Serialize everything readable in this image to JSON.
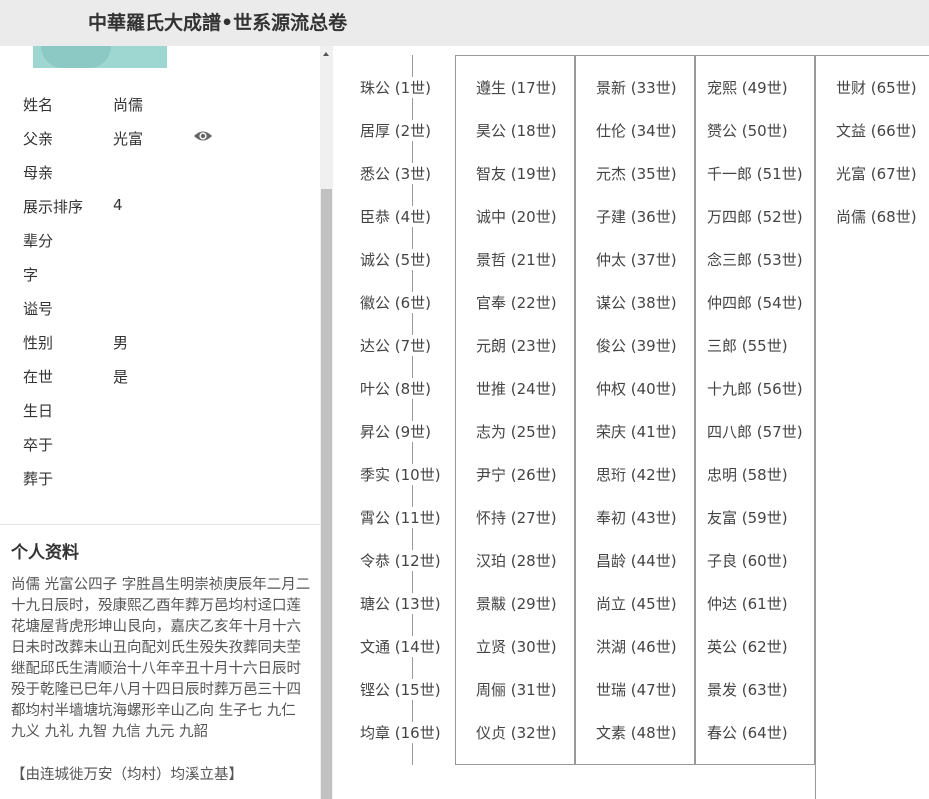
{
  "header": {
    "title": "中華羅氏大成譜•世系源流总卷"
  },
  "person": {
    "fields": [
      {
        "label": "姓名",
        "value": "尚儒"
      },
      {
        "label": "父亲",
        "value": "光富"
      },
      {
        "label": "母亲",
        "value": ""
      },
      {
        "label": "展示排序",
        "value": "4"
      },
      {
        "label": "辈分",
        "value": ""
      },
      {
        "label": "字",
        "value": ""
      },
      {
        "label": "谥号",
        "value": ""
      },
      {
        "label": "性别",
        "value": "男"
      },
      {
        "label": "在世",
        "value": "是"
      },
      {
        "label": "生日",
        "value": ""
      },
      {
        "label": "卒于",
        "value": ""
      },
      {
        "label": "葬于",
        "value": ""
      }
    ],
    "eye_icon": "eye-icon"
  },
  "profile": {
    "title": "个人资料",
    "text": "尚儒 光富公四子 字胜昌生明崇祯庚辰年二月二十九日辰时，殁康熙乙酉年葬万邑均村迳口莲花塘屋背虎形坤山艮向，嘉庆乙亥年十月十六日未时改葬未山丑向配刘氏生殁失孜葬同夫茔 继配邱氏生清顺治十八年辛丑十月十六日辰时殁于乾隆已巳年八月十四日辰时葬万邑三十四都均村半墙塘坑海螺形辛山乙向 生子七 九仁 九义 九礼 九智 九信 九元 九韶",
    "footer": "【由连城徙万安（均村）均溪立基】"
  },
  "lineage": {
    "columns": [
      [
        "珠公 (1世)",
        "居厚 (2世)",
        "悉公 (3世)",
        "臣恭 (4世)",
        "诚公 (5世)",
        "徽公 (6世)",
        "达公 (7世)",
        "叶公 (8世)",
        "昇公 (9世)",
        "季实 (10世)",
        "霄公 (11世)",
        "令恭 (12世)",
        "瑭公 (13世)",
        "文通 (14世)",
        "铿公 (15世)",
        "均章 (16世)"
      ],
      [
        "遵生 (17世)",
        "昊公 (18世)",
        "智友 (19世)",
        "诚中 (20世)",
        "景哲 (21世)",
        "官奉 (22世)",
        "元朗 (23世)",
        "世推 (24世)",
        "志为 (25世)",
        "尹宁 (26世)",
        "怀持 (27世)",
        "汉珀 (28世)",
        "景黻 (29世)",
        "立贤 (30世)",
        "周俪 (31世)",
        "仪贞 (32世)"
      ],
      [
        "景新 (33世)",
        "仕伦 (34世)",
        "元杰 (35世)",
        "子建 (36世)",
        "仲太 (37世)",
        "谋公 (38世)",
        "俊公 (39世)",
        "仲权 (40世)",
        "荣庆 (41世)",
        "思珩 (42世)",
        "奉初 (43世)",
        "昌龄 (44世)",
        "尚立 (45世)",
        "洪湖 (46世)",
        "世瑞 (47世)",
        "文素 (48世)"
      ],
      [
        "宠熙 (49世)",
        "赟公 (50世)",
        "千一郎 (51世)",
        "万四郎 (52世)",
        "念三郎 (53世)",
        "仲四郎 (54世)",
        "三郎 (55世)",
        "十九郎 (56世)",
        "四八郎 (57世)",
        "忠明 (58世)",
        "友富 (59世)",
        "子良 (60世)",
        "仲达 (61世)",
        "英公 (62世)",
        "景发 (63世)",
        "春公 (64世)"
      ],
      [
        "世财 (65世)",
        "文益 (66世)",
        "光富 (67世)",
        "尚儒 (68世)"
      ]
    ]
  }
}
